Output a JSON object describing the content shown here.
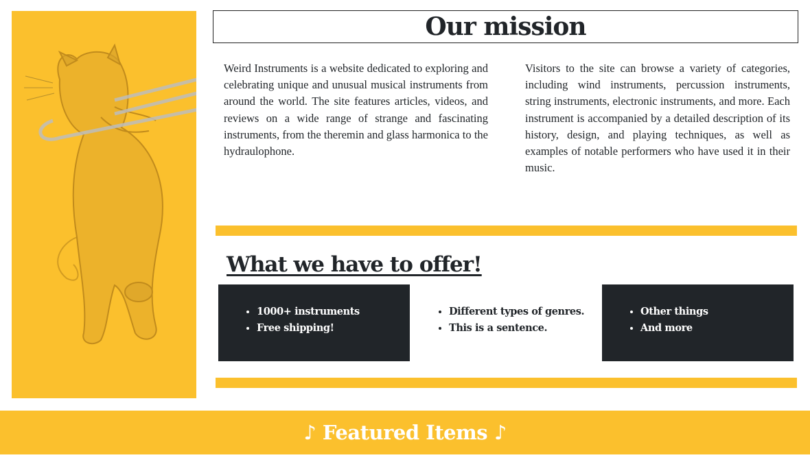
{
  "mission": {
    "title": "Our mission",
    "paragraph_left": "Weird Instruments is a website dedicated to exploring and celebrating unique and unusual musical instruments from around the world. The site features articles, videos, and reviews on a wide range of strange and fascinating instruments, from the theremin and glass harmonica to the hydraulophone.",
    "paragraph_right": "Visitors to the site can browse a variety of categories, including wind instruments, percussion instruments, string instruments, electronic instruments, and more. Each instrument is accompanied by a detailed description of its history, design, and playing techniques, as well as examples of notable performers who have used it in their music."
  },
  "offer": {
    "title": "What we have to offer!",
    "boxes": [
      {
        "items": [
          "1000+ instruments",
          "Free shipping!"
        ]
      },
      {
        "items": [
          "Different types of genres.",
          "This is a sentence."
        ]
      },
      {
        "items": [
          "Other things",
          "And more"
        ]
      }
    ]
  },
  "featured": {
    "title": "♪ Featured Items ♪"
  },
  "colors": {
    "accent": "#fbc02d",
    "dark": "#212529",
    "white": "#ffffff"
  },
  "illustration": {
    "icon": "cat-playing-trombone-icon"
  }
}
